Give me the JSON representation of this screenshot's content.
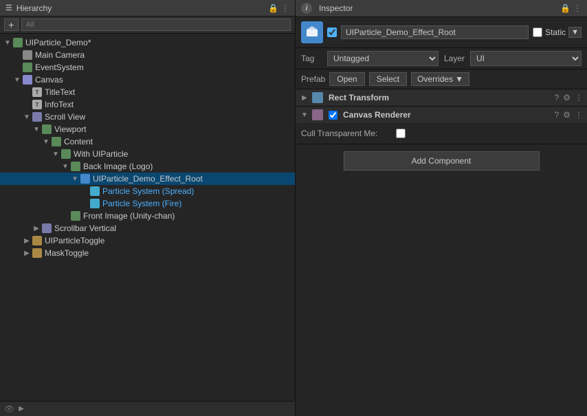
{
  "hierarchy": {
    "title": "Hierarchy",
    "search_placeholder": "All",
    "items": [
      {
        "id": "UIParticle_Demo",
        "label": "UIParticle_Demo*",
        "depth": 0,
        "arrow": "expanded",
        "icon": "gameobj",
        "selected": false,
        "modified": true
      },
      {
        "id": "MainCamera",
        "label": "Main Camera",
        "depth": 1,
        "arrow": "empty",
        "icon": "camera",
        "selected": false
      },
      {
        "id": "EventSystem",
        "label": "EventSystem",
        "depth": 1,
        "arrow": "empty",
        "icon": "gameobj",
        "selected": false
      },
      {
        "id": "Canvas",
        "label": "Canvas",
        "depth": 1,
        "arrow": "expanded",
        "icon": "canvas",
        "selected": false
      },
      {
        "id": "TitleText",
        "label": "TitleText",
        "depth": 2,
        "arrow": "empty",
        "icon": "text",
        "selected": false
      },
      {
        "id": "InfoText",
        "label": "InfoText",
        "depth": 2,
        "arrow": "empty",
        "icon": "text",
        "selected": false
      },
      {
        "id": "ScrollView",
        "label": "Scroll View",
        "depth": 2,
        "arrow": "expanded",
        "icon": "scroll",
        "selected": false
      },
      {
        "id": "Viewport",
        "label": "Viewport",
        "depth": 3,
        "arrow": "expanded",
        "icon": "gameobj",
        "selected": false
      },
      {
        "id": "Content",
        "label": "Content",
        "depth": 4,
        "arrow": "expanded",
        "icon": "gameobj",
        "selected": false
      },
      {
        "id": "WithUIParticle",
        "label": "With UIParticle",
        "depth": 5,
        "arrow": "expanded",
        "icon": "gameobj",
        "selected": false
      },
      {
        "id": "BackImageLogo",
        "label": "Back Image (Logo)",
        "depth": 6,
        "arrow": "expanded",
        "icon": "gameobj",
        "selected": false
      },
      {
        "id": "UIParticleDemoEffectRoot",
        "label": "UIParticle_Demo_Effect_Root",
        "depth": 7,
        "arrow": "expanded",
        "icon": "gameobj-blue",
        "selected": true
      },
      {
        "id": "ParticleSpread",
        "label": "Particle System (Spread)",
        "depth": 8,
        "arrow": "empty",
        "icon": "particle",
        "selected": false,
        "highlight": true
      },
      {
        "id": "ParticleFire",
        "label": "Particle System (Fire)",
        "depth": 8,
        "arrow": "empty",
        "icon": "particle",
        "selected": false,
        "highlight": true
      },
      {
        "id": "FrontImage",
        "label": "Front Image (Unity-chan)",
        "depth": 6,
        "arrow": "empty",
        "icon": "gameobj",
        "selected": false
      },
      {
        "id": "ScrollbarVertical",
        "label": "Scrollbar Vertical",
        "depth": 3,
        "arrow": "collapsed",
        "icon": "scroll",
        "selected": false
      },
      {
        "id": "UIParticleToggle",
        "label": "UIParticleToggle",
        "depth": 2,
        "arrow": "collapsed",
        "icon": "toggle",
        "selected": false
      },
      {
        "id": "MaskToggle",
        "label": "MaskToggle",
        "depth": 2,
        "arrow": "collapsed",
        "icon": "toggle",
        "selected": false
      }
    ]
  },
  "inspector": {
    "title": "Inspector",
    "gameobject_name": "UIParticle_Demo_Effect_Root",
    "tag": "Untagged",
    "layer": "UI",
    "static_label": "Static",
    "prefab_label": "Prefab",
    "open_label": "Open",
    "select_label": "Select",
    "overrides_label": "Overrides",
    "components": [
      {
        "id": "rect_transform",
        "title": "Rect Transform",
        "arrow": "collapsed",
        "enabled": null,
        "fields": []
      },
      {
        "id": "canvas_renderer",
        "title": "Canvas Renderer",
        "arrow": "expanded",
        "enabled": true,
        "fields": [
          {
            "label": "Cull Transparent Me:",
            "type": "checkbox",
            "value": false
          }
        ]
      }
    ],
    "add_component_label": "Add Component"
  }
}
